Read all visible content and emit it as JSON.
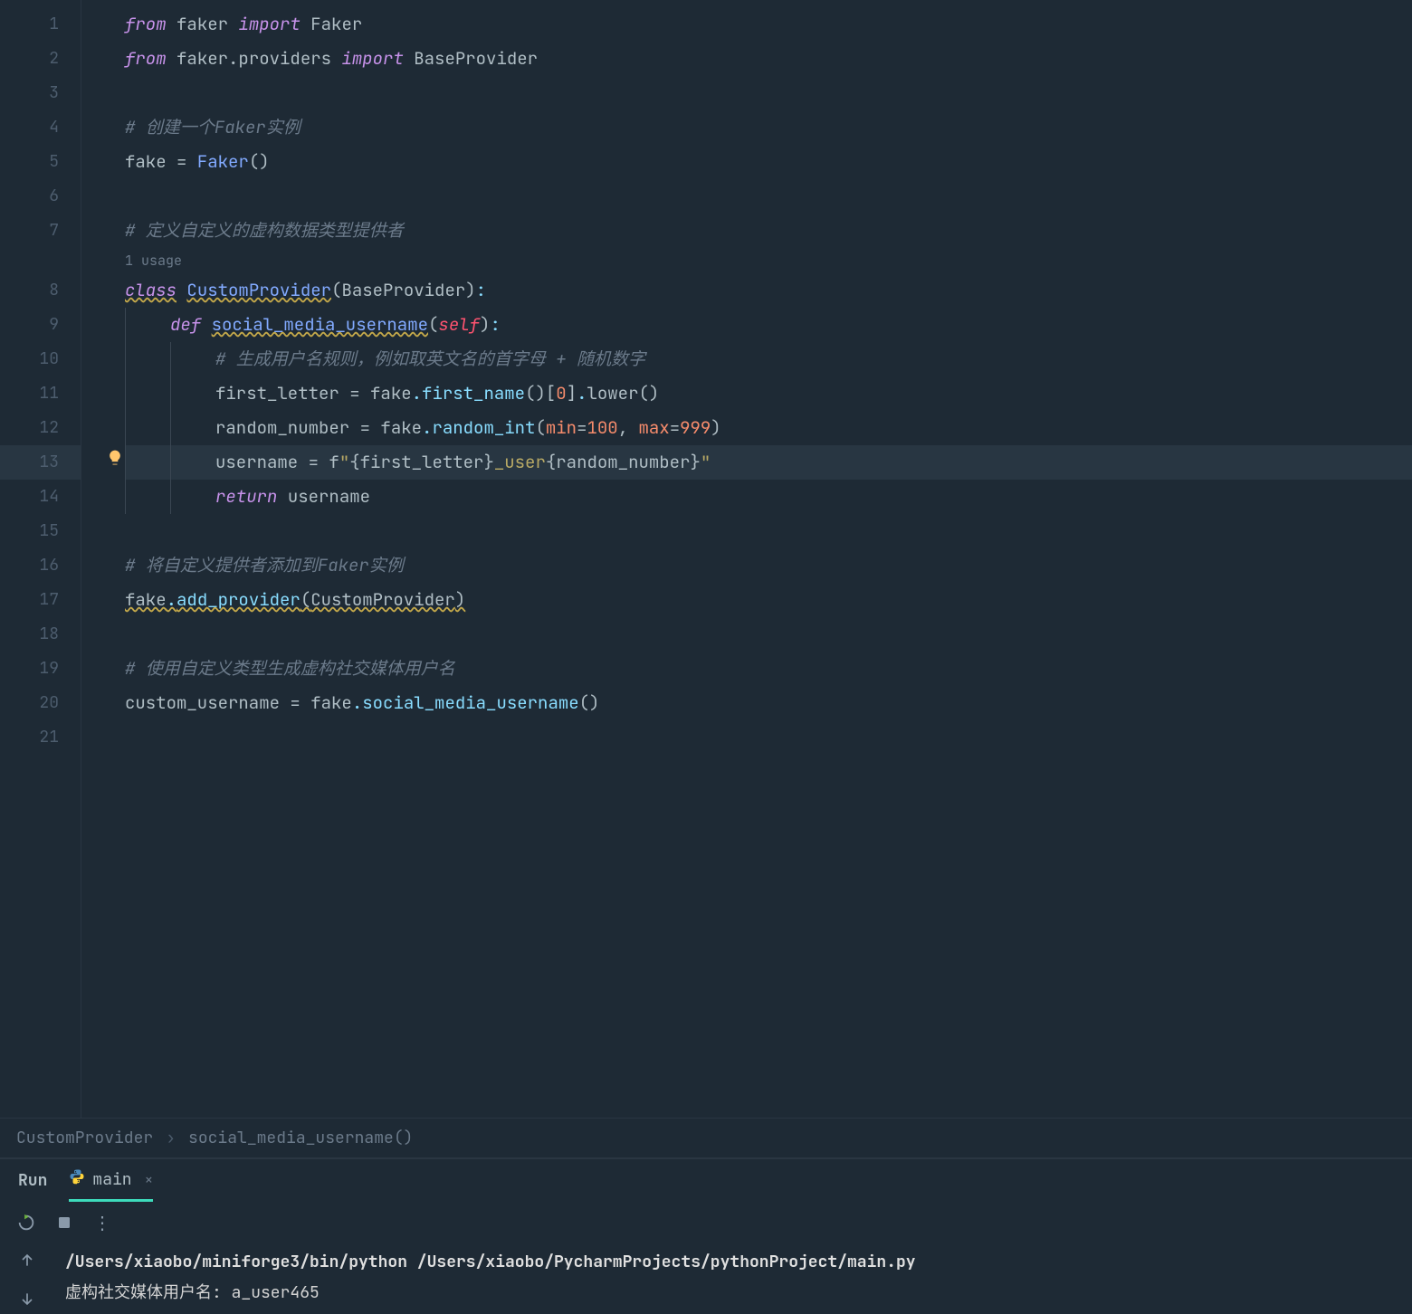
{
  "gutter": {
    "lines": [
      "1",
      "2",
      "3",
      "4",
      "5",
      "6",
      "7",
      "8",
      "9",
      "10",
      "11",
      "12",
      "13",
      "14",
      "15",
      "16",
      "17",
      "18",
      "19",
      "20",
      "21"
    ],
    "highlighted_line": 13,
    "bulb_line": 13
  },
  "code": {
    "usage_hint": "1 usage",
    "tokens": {
      "from1": "from",
      "faker_mod": "faker",
      "import1": "import",
      "Faker": "Faker",
      "from2": "from",
      "faker_providers": "faker.providers",
      "import2": "import",
      "BaseProvider": "BaseProvider",
      "comment1_a": "# ",
      "comment1_b": "创建一个",
      "comment1_c": "Faker",
      "comment1_d": "实例",
      "fake_var": "fake",
      "eq": " = ",
      "Faker_call": "Faker",
      "parens": "()",
      "comment2": "# 定义自定义的虚构数据类型提供者",
      "class_kw": "class",
      "CustomProvider": "CustomProvider",
      "BaseProvider2": "BaseProvider",
      "def_kw": "def",
      "social_media_username": "social_media_username",
      "self": "self",
      "comment3": "# 生成用户名规则，例如取英文名的首字母 + 随机数字",
      "first_letter": "first_letter",
      "fake_ref": "fake",
      "first_name": "first_name",
      "zero": "0",
      "lower": "lower",
      "random_number": "random_number",
      "random_int": "random_int",
      "min_kw": "min",
      "min_val": "100",
      "max_kw": "max",
      "max_val": "999",
      "username": "username",
      "fstring_prefix": "f",
      "fstring_q1": "\"",
      "fstring_br1": "{",
      "fstring_var1": "first_letter",
      "fstring_br2": "}",
      "fstring_text": "_user",
      "fstring_br3": "{",
      "fstring_var2": "random_number",
      "fstring_br4": "}",
      "fstring_q2": "\"",
      "return_kw": "return",
      "comment4_a": "# 将自定义提供者添加到",
      "comment4_b": "Faker",
      "comment4_c": "实例",
      "add_provider": "add_provider",
      "comment5": "# 使用自定义类型生成虚构社交媒体用户名",
      "custom_username": "custom_username",
      "social_call": "social_media_username"
    }
  },
  "breadcrumb": {
    "class": "CustomProvider",
    "method": "social_media_username()"
  },
  "run": {
    "label": "Run",
    "tab_name": "main",
    "command": "/Users/xiaobo/miniforge3/bin/python /Users/xiaobo/PycharmProjects/pythonProject/main.py",
    "output": "虚构社交媒体用户名: a_user465"
  }
}
